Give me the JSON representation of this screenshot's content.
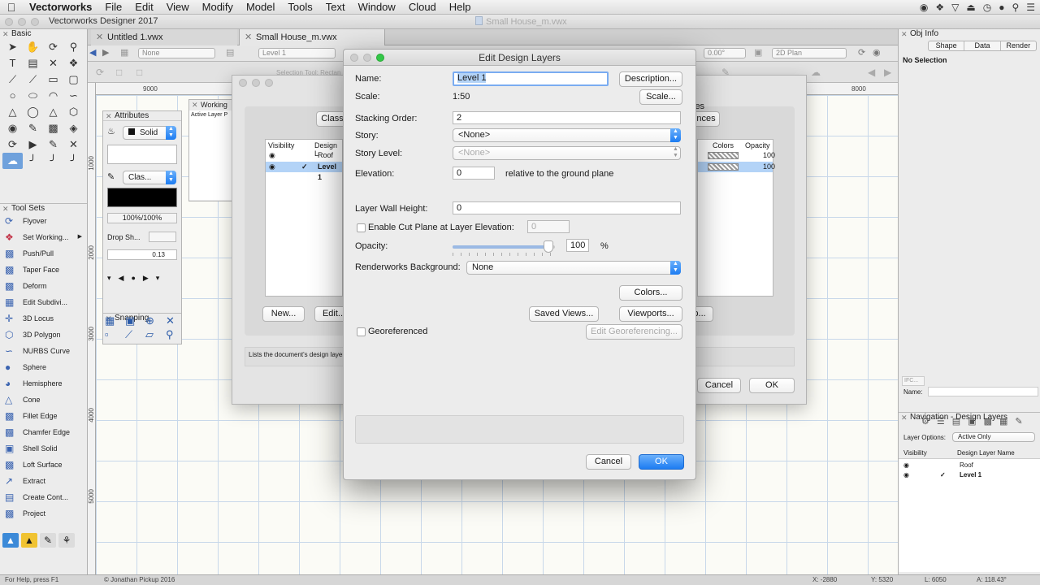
{
  "menubar": {
    "app": "Vectorworks",
    "items": [
      "File",
      "Edit",
      "View",
      "Modify",
      "Model",
      "Tools",
      "Text",
      "Window",
      "Cloud",
      "Help"
    ]
  },
  "window": {
    "title": "Vectorworks Designer 2017",
    "doc_title": "Small House_m.vwx"
  },
  "tabs": [
    {
      "label": "Untitled 1.vwx"
    },
    {
      "label": "Small House_m.vwx"
    }
  ],
  "toolbar": {
    "class_value": "None",
    "layer_value": "Level 1",
    "selection_hint": "Selection Tool: Rectan",
    "angle_value": "0.00°",
    "view_value": "2D Plan"
  },
  "ruler": {
    "h_ticks": [
      "9000",
      "8000",
      "8000"
    ],
    "v_ticks": [
      "1000",
      "2000",
      "3000",
      "4000",
      "5000"
    ]
  },
  "basic_palette": {
    "title": "Basic"
  },
  "tool_sets": {
    "title": "Tool Sets",
    "items": [
      "Flyover",
      "Set Working...",
      "Push/Pull",
      "Taper Face",
      "Deform",
      "Edit Subdivi...",
      "3D Locus",
      "3D Polygon",
      "NURBS Curve",
      "Sphere",
      "Hemisphere",
      "Cone",
      "Fillet Edge",
      "Chamfer Edge",
      "Shell Solid",
      "Loft Surface",
      "Extract",
      "Create Cont...",
      "Project"
    ]
  },
  "attributes": {
    "title": "Attributes",
    "fill_value": "Solid",
    "pen_value": "Clas...",
    "opacity": "100%/100%",
    "drop_shadow": "Drop Sh...",
    "line_weight": "0.13"
  },
  "snapping": {
    "title": "Snapping"
  },
  "working_palette": {
    "title": "Working",
    "active_layer": "Active Layer P"
  },
  "org_dialog": {
    "tab_classes": "Class",
    "tab_references": "ences",
    "tab_visibility_partial": "ies",
    "columns": [
      "Visibility",
      "Design L",
      "Colors",
      "Opacity"
    ],
    "rows": [
      {
        "name": "Roof",
        "opacity": "100",
        "active": false
      },
      {
        "name": "Level 1",
        "opacity": "100",
        "active": true
      }
    ],
    "new_button": "New...",
    "edit_button": "Edit...",
    "setup_button": "up...",
    "status_text": "Lists the document's design layer",
    "cancel_button": "Cancel",
    "ok_button": "OK"
  },
  "edit_dialog": {
    "title": "Edit Design Layers",
    "name_label": "Name:",
    "name_value": "Level 1",
    "description_button": "Description...",
    "scale_label": "Scale:",
    "scale_value": "1:50",
    "scale_button": "Scale...",
    "stacking_label": "Stacking Order:",
    "stacking_value": "2",
    "story_label": "Story:",
    "story_value": "<None>",
    "story_level_label": "Story Level:",
    "story_level_value": "<None>",
    "elevation_label": "Elevation:",
    "elevation_value": "0",
    "elevation_note": "relative to the ground plane",
    "wall_height_label": "Layer Wall Height:",
    "wall_height_value": "0",
    "cut_plane_label": "Enable Cut Plane at Layer Elevation:",
    "cut_plane_value": "0",
    "opacity_label": "Opacity:",
    "opacity_value": "100",
    "opacity_fraction": 0.98,
    "opacity_unit": "%",
    "renderworks_label": "Renderworks Background:",
    "renderworks_value": "None",
    "colors_button": "Colors...",
    "saved_views_button": "Saved Views...",
    "viewports_button": "Viewports...",
    "georeferenced_label": "Georeferenced",
    "edit_geo_button": "Edit Georeferencing...",
    "cancel_button": "Cancel",
    "ok_button": "OK"
  },
  "obj_info": {
    "title": "Obj Info",
    "tabs": [
      "Shape",
      "Data",
      "Render"
    ],
    "selection": "No Selection",
    "ifc": "IFC...",
    "name_label": "Name:"
  },
  "navigation": {
    "title": "Navigation - Design Layers",
    "layer_options_label": "Layer Options:",
    "layer_options_value": "Active Only",
    "columns": [
      "Visibility",
      "Design Layer Name"
    ],
    "rows": [
      {
        "name": "Roof",
        "active": false
      },
      {
        "name": "Level 1",
        "active": true
      }
    ]
  },
  "status_bar": {
    "help": "For Help, press F1",
    "credit": "© Jonathan Pickup 2016",
    "x": "X: -2880",
    "y": "Y: 5320",
    "l": "L: 6050",
    "a": "A: 118.43°"
  }
}
